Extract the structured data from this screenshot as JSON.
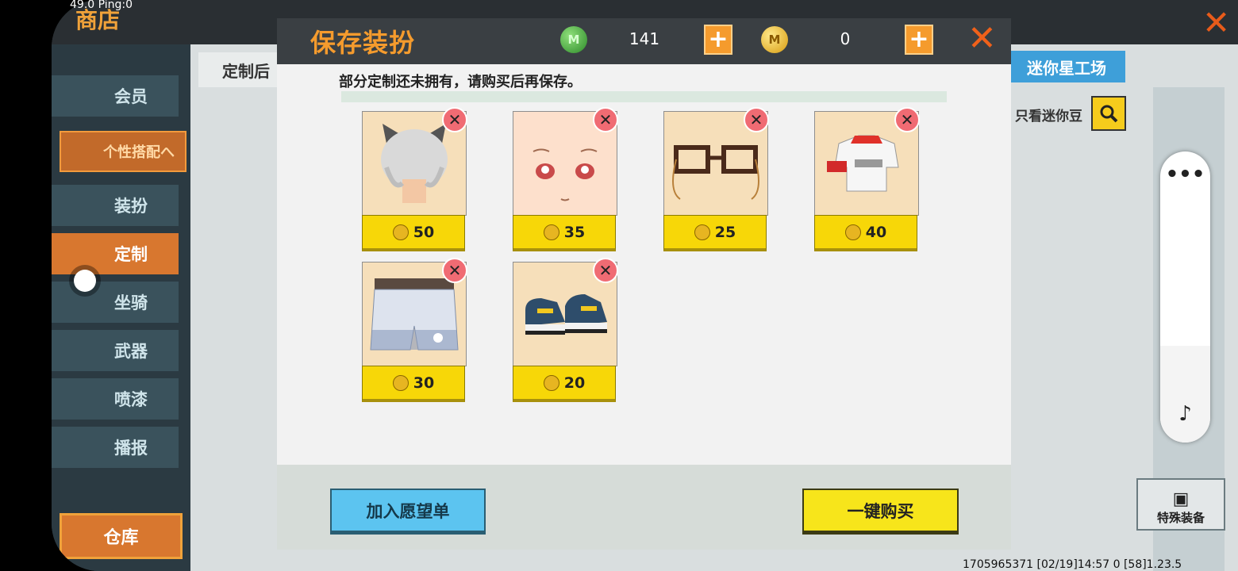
{
  "debug": "49.0 Ping:0",
  "shop": {
    "title": "商店",
    "tab_custom": "定制后",
    "mini_factory": "迷你星工场",
    "mini_filter": "只看迷你豆",
    "side_items": [
      "会员",
      "个性搭配へ",
      "装扮",
      "定制",
      "坐骑",
      "武器",
      "喷漆",
      "播报"
    ],
    "warehouse": "仓库",
    "special": "特殊装备",
    "status": "1705965371   [02/19]14:57 0   [58]1.23.5"
  },
  "dialog": {
    "title": "保存装扮",
    "gems": "141",
    "coins": "0",
    "message": "部分定制还未拥有，请购买后再保存。",
    "items": [
      {
        "name": "cat-ear-hair",
        "price": "50"
      },
      {
        "name": "face",
        "price": "35"
      },
      {
        "name": "glasses",
        "price": "25"
      },
      {
        "name": "shirt",
        "price": "40"
      },
      {
        "name": "shorts",
        "price": "30"
      },
      {
        "name": "shoes",
        "price": "20"
      }
    ],
    "wishlist_label": "加入愿望单",
    "buy_label": "一键购买"
  },
  "float": {
    "dots": "•••",
    "music": "♪"
  }
}
